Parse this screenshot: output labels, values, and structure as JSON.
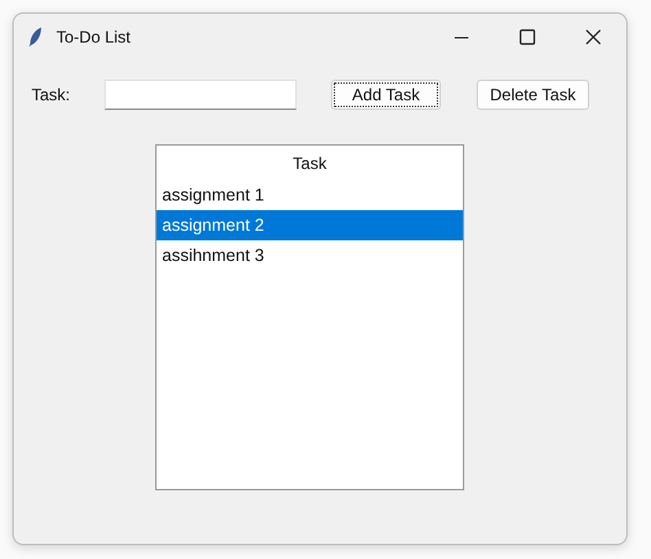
{
  "window": {
    "title": "To-Do List"
  },
  "task_label": "Task:",
  "buttons": [
    {
      "label": "Add Task",
      "focused": true
    },
    {
      "label": "Delete Task",
      "focused": false
    }
  ],
  "list": {
    "header": "Task",
    "rows": [
      {
        "text": "assignment 1",
        "selected": false
      },
      {
        "text": "assignment 2",
        "selected": true
      },
      {
        "text": "assihnment 3",
        "selected": false
      }
    ]
  }
}
